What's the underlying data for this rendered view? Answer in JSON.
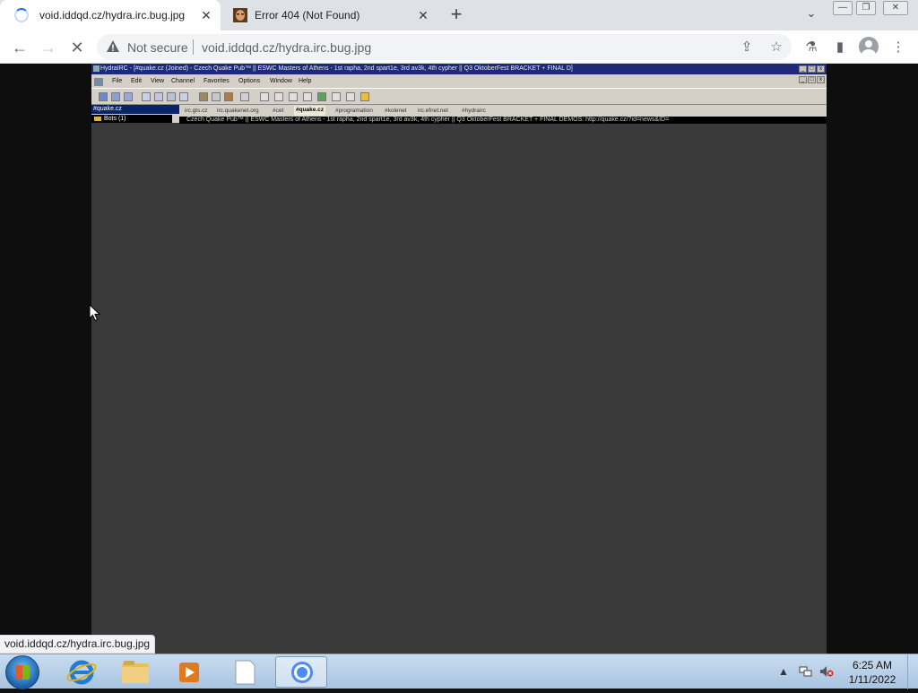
{
  "browser": {
    "tabs": [
      {
        "title": "void.iddqd.cz/hydra.irc.bug.jpg",
        "loading": true,
        "active": true
      },
      {
        "title": "Error 404 (Not Found)",
        "loading": false,
        "active": false
      }
    ],
    "new_tab_label": "+",
    "tab_search_label": "⌄",
    "window_controls": [
      "—",
      "❐",
      "✕"
    ],
    "security_label": "Not secure",
    "url": "void.iddqd.cz/hydra.irc.bug.jpg",
    "status_bubble": "void.iddqd.cz/hydra.irc.bug.jpg",
    "icons": {
      "back": "←",
      "forward": "→",
      "stop": "✕",
      "share": "⇪",
      "star": "☆",
      "extension": "⚗",
      "sidepanel": "▮",
      "menu": "⋮"
    }
  },
  "hydra": {
    "title": "HydraIRC - [#quake.cz (Joined) - Czech Quake Pub™ || ESWC Masters of Athens - 1st rapha, 2nd spart1e, 3rd av3k, 4th cypher || Q3 OktoberFest BRACKET + FINAL D]",
    "menu": [
      "File",
      "Edit",
      "View",
      "Channel",
      "Favorites",
      "Options",
      "Window",
      "Help"
    ],
    "sidebar_title": "#quake.cz",
    "sidebar_item": "Bots (1)",
    "tabs": [
      "irc.gts.cz",
      "irc.quakenet.org",
      "#cet",
      "#quake.cz",
      "#programation",
      "#kolenet",
      "irc.efnet.net",
      "#hydrairc"
    ],
    "selected_tab": "#quake.cz",
    "topic": "Czech Quake Pub™ || ESWC Masters of Athens - 1st rapha, 2nd spart1e, 3rd av3k, 4th cypher || Q3 OktoberFest BRACKET + FINAL DEMOS: http://quake.cz/?id=news&ID="
  },
  "taskbar": {
    "apps": [
      "internet-explorer",
      "file-explorer",
      "media-player",
      "notepad",
      "chrome"
    ],
    "clock_time": "6:25 AM",
    "clock_date": "1/11/2022"
  }
}
